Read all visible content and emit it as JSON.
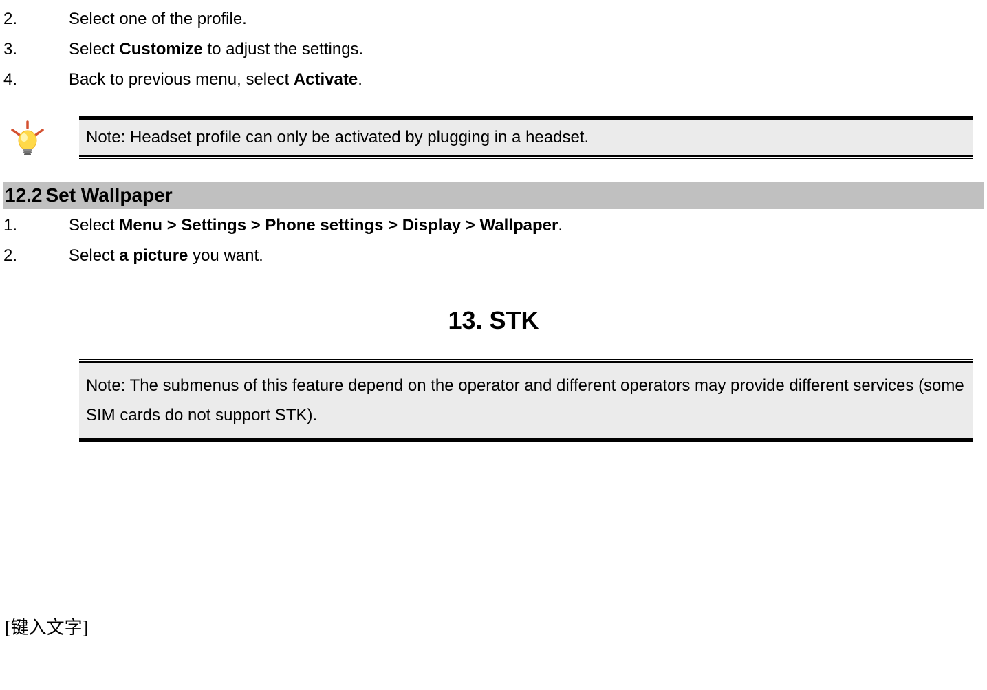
{
  "list1": {
    "items": [
      {
        "num": "2.",
        "text": "Select one of the profile."
      },
      {
        "num": "3.",
        "prefix": "Select ",
        "bold": "Customize",
        "suffix": " to adjust the settings."
      },
      {
        "num": "4.",
        "prefix": "Back to previous menu, select ",
        "bold": "Activate",
        "suffix": "."
      }
    ]
  },
  "note1": "Note: Headset profile can only be activated by plugging in a headset.",
  "section": {
    "number": "12.2",
    "title": "Set Wallpaper"
  },
  "list2": {
    "items": [
      {
        "num": "1.",
        "prefix": "Select ",
        "bold": "Menu > Settings > Phone settings > Display > Wallpaper",
        "suffix": "."
      },
      {
        "num": "2.",
        "prefix": "Select ",
        "bold": "a picture",
        "suffix": " you want."
      }
    ]
  },
  "main_heading": "13. STK",
  "note2": "Note: The submenus of this feature depend on the operator and different operators may provide different services (some SIM cards do not support STK).",
  "footer": "[键入文字]"
}
